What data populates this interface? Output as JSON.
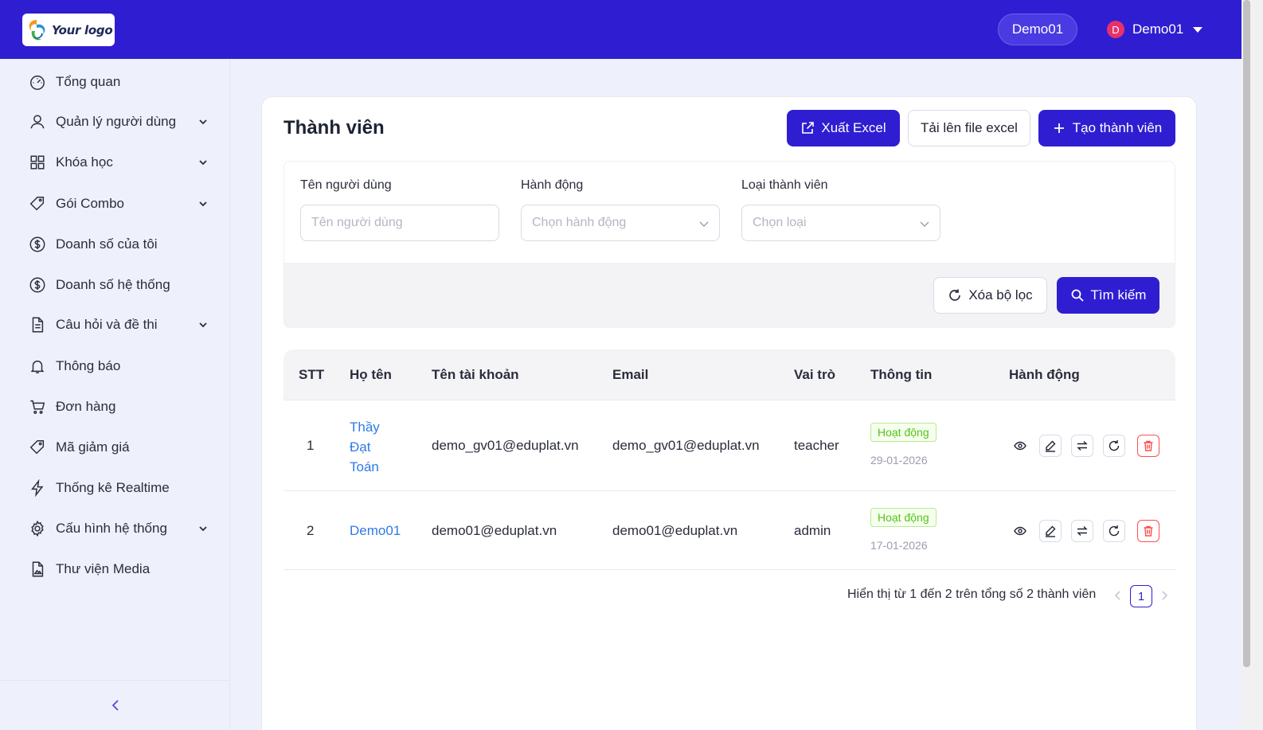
{
  "header": {
    "logo_text": "Your logo",
    "org_label": "Demo01",
    "user": {
      "avatar_initial": "D",
      "name": "Demo01"
    }
  },
  "sidebar": {
    "items": [
      {
        "label": "Tổng quan",
        "icon": "dashboard-icon",
        "expandable": false
      },
      {
        "label": "Quản lý người dùng",
        "icon": "user-icon",
        "expandable": true
      },
      {
        "label": "Khóa học",
        "icon": "grid-icon",
        "expandable": true
      },
      {
        "label": "Gói Combo",
        "icon": "tag-icon",
        "expandable": true
      },
      {
        "label": "Doanh số của tôi",
        "icon": "dollar-icon",
        "expandable": false
      },
      {
        "label": "Doanh số hệ thống",
        "icon": "dollar-icon",
        "expandable": false
      },
      {
        "label": "Câu hỏi và đề thi",
        "icon": "document-icon",
        "expandable": true
      },
      {
        "label": "Thông báo",
        "icon": "bell-icon",
        "expandable": false
      },
      {
        "label": "Đơn hàng",
        "icon": "cart-icon",
        "expandable": false
      },
      {
        "label": "Mã giảm giá",
        "icon": "tag-icon",
        "expandable": false
      },
      {
        "label": "Thống kê Realtime",
        "icon": "bolt-icon",
        "expandable": false
      },
      {
        "label": "Cấu hình hệ thống",
        "icon": "gear-icon",
        "expandable": true
      },
      {
        "label": "Thư viện Media",
        "icon": "media-file-icon",
        "expandable": false
      }
    ]
  },
  "page": {
    "title": "Thành viên",
    "export_label": "Xuất Excel",
    "upload_label": "Tải lên file excel",
    "create_label": "Tạo thành viên"
  },
  "filters": {
    "username": {
      "label": "Tên người dùng",
      "placeholder": "Tên người dùng"
    },
    "action": {
      "label": "Hành động",
      "placeholder": "Chọn hành động"
    },
    "member_type": {
      "label": "Loại thành viên",
      "placeholder": "Chọn loại"
    },
    "clear_label": "Xóa bộ lọc",
    "search_label": "Tìm kiếm"
  },
  "table": {
    "columns": [
      "STT",
      "Họ tên",
      "Tên tài khoản",
      "Email",
      "Vai trò",
      "Thông tin",
      "Hành động"
    ],
    "rows": [
      {
        "stt": "1",
        "name_lines": [
          "Thầy",
          "Đạt",
          "Toán"
        ],
        "username": "demo_gv01@eduplat.vn",
        "email": "demo_gv01@eduplat.vn",
        "role": "teacher",
        "status": "Hoạt động",
        "date": "29-01-2026"
      },
      {
        "stt": "2",
        "name_lines": [
          "Demo01"
        ],
        "username": "demo01@eduplat.vn",
        "email": "demo01@eduplat.vn",
        "role": "admin",
        "status": "Hoạt động",
        "date": "17-01-2026"
      }
    ]
  },
  "pagination": {
    "summary": "Hiển thị từ 1 đến 2 trên tổng số 2 thành viên",
    "current_page": "1"
  },
  "colors": {
    "primary": "#2f1ed1",
    "link": "#2f7be6",
    "success": "#52c41a",
    "danger": "#ff4d4f"
  }
}
